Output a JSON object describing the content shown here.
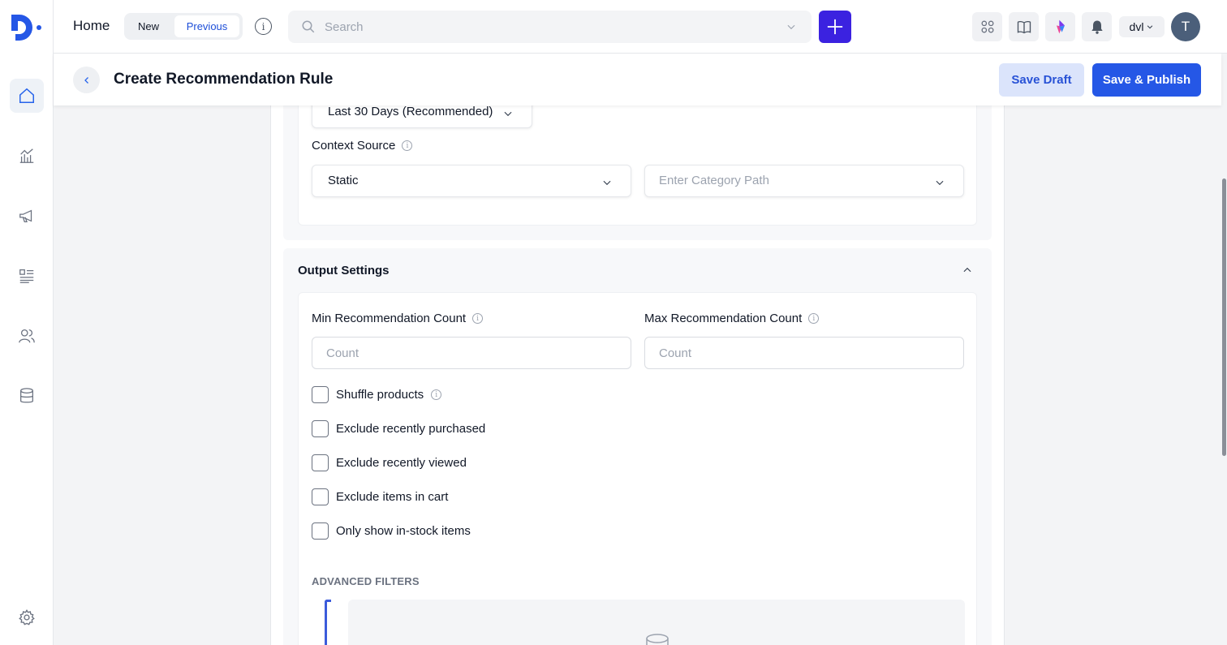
{
  "nav": {
    "items": [
      {
        "icon": "home-icon",
        "active": true
      },
      {
        "icon": "analytics-icon",
        "active": false
      },
      {
        "icon": "megaphone-icon",
        "active": false
      },
      {
        "icon": "content-list-icon",
        "active": false
      },
      {
        "icon": "audience-icon",
        "active": false
      },
      {
        "icon": "database-icon",
        "active": false
      }
    ],
    "settings_icon": "gear-icon"
  },
  "topbar": {
    "home_label": "Home",
    "toggle": {
      "new_label": "New",
      "previous_label": "Previous",
      "selected": "Previous"
    },
    "search": {
      "placeholder": "Search",
      "value": ""
    },
    "org_label": "dvl",
    "avatar_initial": "T"
  },
  "header": {
    "title": "Create Recommendation Rule",
    "save_draft_label": "Save Draft",
    "publish_label": "Save & Publish"
  },
  "context": {
    "time_range_value": "Last 30 Days (Recommended)",
    "source_label": "Context Source",
    "source_value": "Static",
    "category_path_placeholder": "Enter Category Path"
  },
  "output": {
    "title": "Output Settings",
    "min_label": "Min Recommendation Count",
    "min_placeholder": "Count",
    "max_label": "Max Recommendation Count",
    "max_placeholder": "Count",
    "options": [
      {
        "label": "Shuffle products",
        "checked": false
      },
      {
        "label": "Exclude recently purchased",
        "checked": false
      },
      {
        "label": "Exclude recently viewed",
        "checked": false
      },
      {
        "label": "Exclude items in cart",
        "checked": false
      },
      {
        "label": "Only show in-stock items",
        "checked": false
      }
    ],
    "advanced_title": "ADVANCED FILTERS"
  },
  "colors": {
    "primary": "#2557e6",
    "plus_button": "#3b22e0",
    "draft_bg": "#dbe4fb",
    "avatar_bg": "#4b5f7a"
  }
}
